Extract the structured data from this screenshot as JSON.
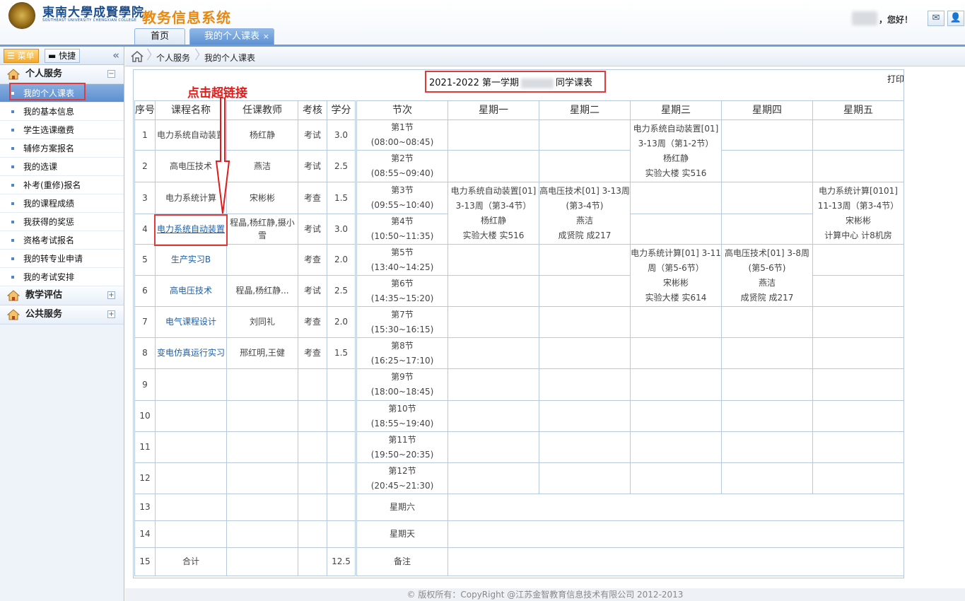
{
  "header": {
    "school_cn": "東南大學成賢學院",
    "school_en": "SOUTHEAST UNIVERSITY CHENGXIAN COLLEGE",
    "system_title": "教务信息系统",
    "greeting": "，您好！",
    "mail_icon": "mail-icon",
    "user_icon": "user-icon"
  },
  "tabs": [
    {
      "label": "首页"
    },
    {
      "label": "我的个人课表",
      "close": "×"
    }
  ],
  "sidebar": {
    "menu_label": "菜单",
    "quick_label": "快捷",
    "collapse": "«",
    "groups": [
      {
        "label": "个人服务",
        "toggle": "−",
        "items": [
          "我的个人课表",
          "我的基本信息",
          "学生选课缴费",
          "辅修方案报名",
          "我的选课",
          "补考(重修)报名",
          "我的课程成绩",
          "我获得的奖惩",
          "资格考试报名",
          "我的转专业申请",
          "我的考试安排"
        ]
      },
      {
        "label": "教学评估",
        "toggle": "+"
      },
      {
        "label": "公共服务",
        "toggle": "+"
      }
    ]
  },
  "breadcrumb": [
    "个人服务",
    "我的个人课表"
  ],
  "content": {
    "title_left": "2021-2022 第一学期",
    "title_right": "同学课表",
    "print": "打印"
  },
  "annotation": {
    "text": "点击超链接",
    "color": "#e21b1b"
  },
  "table": {
    "headers": [
      "序号",
      "课程名称",
      "任课教师",
      "考核",
      "学分",
      "节次",
      "星期一",
      "星期二",
      "星期三",
      "星期四",
      "星期五"
    ],
    "courses": [
      {
        "no": "1",
        "name": "电力系统自动装置",
        "teacher": "杨红静",
        "exam": "考试",
        "credit": "3.0"
      },
      {
        "no": "2",
        "name": "高电压技术",
        "teacher": "燕洁",
        "exam": "考试",
        "credit": "2.5"
      },
      {
        "no": "3",
        "name": "电力系统计算",
        "teacher": "宋彬彬",
        "exam": "考查",
        "credit": "1.5"
      },
      {
        "no": "4",
        "name": "电力系统自动装置",
        "teacher": "程晶,杨红静,摄小雪",
        "exam": "考试",
        "credit": "3.0"
      },
      {
        "no": "5",
        "name": "生产实习B",
        "teacher": "",
        "exam": "考查",
        "credit": "2.0"
      },
      {
        "no": "6",
        "name": "高电压技术",
        "teacher": "程晶,杨红静...",
        "exam": "考试",
        "credit": "2.5"
      },
      {
        "no": "7",
        "name": "电气课程设计",
        "teacher": "刘同礼",
        "exam": "考查",
        "credit": "2.0"
      },
      {
        "no": "8",
        "name": "变电仿真运行实习",
        "teacher": "邢红明,王健",
        "exam": "考查",
        "credit": "1.5"
      },
      {
        "no": "9",
        "name": "",
        "teacher": "",
        "exam": "",
        "credit": ""
      },
      {
        "no": "10",
        "name": "",
        "teacher": "",
        "exam": "",
        "credit": ""
      },
      {
        "no": "11",
        "name": "",
        "teacher": "",
        "exam": "",
        "credit": ""
      },
      {
        "no": "12",
        "name": "",
        "teacher": "",
        "exam": "",
        "credit": ""
      },
      {
        "no": "13",
        "name": "",
        "teacher": "",
        "exam": "",
        "credit": ""
      },
      {
        "no": "14",
        "name": "",
        "teacher": "",
        "exam": "",
        "credit": ""
      },
      {
        "no": "15",
        "name": "合计",
        "teacher": "",
        "exam": "",
        "credit": "12.5"
      }
    ],
    "periods": [
      {
        "name": "第1节",
        "time": "(08:00~08:45)"
      },
      {
        "name": "第2节",
        "time": "(08:55~09:40)"
      },
      {
        "name": "第3节",
        "time": "(09:55~10:40)"
      },
      {
        "name": "第4节",
        "time": "(10:50~11:35)"
      },
      {
        "name": "第5节",
        "time": "(13:40~14:25)"
      },
      {
        "name": "第6节",
        "time": "(14:35~15:20)"
      },
      {
        "name": "第7节",
        "time": "(15:30~16:15)"
      },
      {
        "name": "第8节",
        "time": "(16:25~17:10)"
      },
      {
        "name": "第9节",
        "time": "(18:00~18:45)"
      },
      {
        "name": "第10节",
        "time": "(18:55~19:40)"
      },
      {
        "name": "第11节",
        "time": "(19:50~20:35)"
      },
      {
        "name": "第12节",
        "time": "(20:45~21:30)"
      }
    ],
    "extra_rows": [
      "星期六",
      "星期天",
      "备注"
    ],
    "blocks": {
      "wed_1_2": [
        "电力系统自动装置[01]",
        "3-13周（第1-2节）",
        "杨红静",
        "实验大楼 实516"
      ],
      "mon_3_4": [
        "电力系统自动装置[01]",
        "3-13周（第3-4节）",
        "杨红静",
        "实验大楼 实516"
      ],
      "tue_3_4": [
        "高电压技术[01] 3-13周",
        "(第3-4节)",
        "燕洁",
        "成贤院 成217"
      ],
      "fri_3_4": [
        "电力系统计算[0101]",
        "11-13周（第3-4节）",
        "宋彬彬",
        "计算中心 计8机房"
      ],
      "wed_5_6": [
        "电力系统计算[01] 3-11",
        "周（第5-6节）",
        "宋彬彬",
        "实验大楼 实614"
      ],
      "thu_5_6": [
        "高电压技术[01] 3-8周",
        "(第5-6节)",
        "燕洁",
        "成贤院 成217"
      ]
    }
  },
  "footer": "© 版权所有：CopyRight @江苏金智教育信息技术有限公司 2012-2013"
}
